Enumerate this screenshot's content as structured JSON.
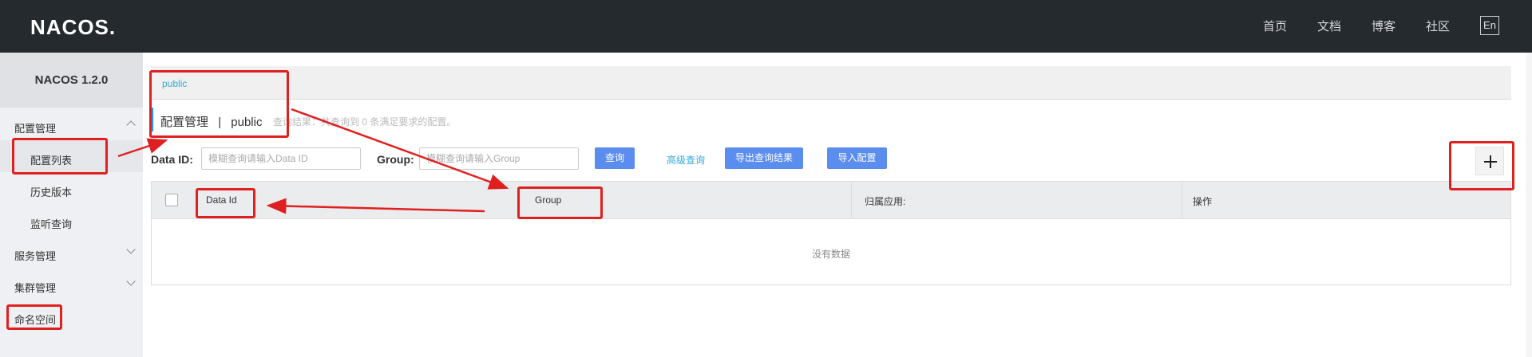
{
  "header": {
    "logo": "NACOS.",
    "nav": [
      "首页",
      "文档",
      "博客",
      "社区"
    ],
    "lang": "En"
  },
  "sidebar": {
    "version": "NACOS 1.2.0",
    "items": [
      {
        "label": "配置管理"
      },
      {
        "label": "配置列表"
      },
      {
        "label": "历史版本"
      },
      {
        "label": "监听查询"
      },
      {
        "label": "服务管理"
      },
      {
        "label": "集群管理"
      },
      {
        "label": "命名空间"
      }
    ]
  },
  "namespace": {
    "current": "public"
  },
  "page": {
    "title": "配置管理",
    "separator": "|",
    "namespace": "public",
    "summary": "查询结果：共查询到 0 条满足要求的配置。"
  },
  "search": {
    "dataid_label": "Data ID:",
    "dataid_placeholder": "模糊查询请输入Data ID",
    "group_label": "Group:",
    "group_placeholder": "模糊查询请输入Group",
    "query_button": "查询",
    "advanced_link": "高级查询",
    "export_button": "导出查询结果",
    "import_button": "导入配置"
  },
  "table": {
    "columns": [
      "Data Id",
      "Group",
      "归属应用:",
      "操作"
    ],
    "empty_text": "没有数据"
  },
  "colors": {
    "topbar": "#252a2f",
    "primary": "#5b8def",
    "link": "#33a9db",
    "annotation": "#e02020"
  }
}
